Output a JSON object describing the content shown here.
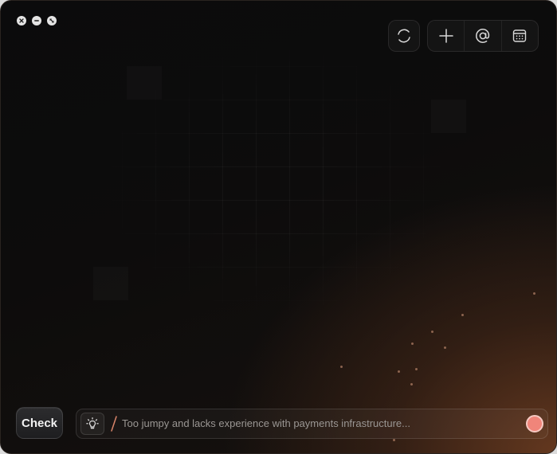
{
  "window": {
    "controls": [
      {
        "name": "close-icon"
      },
      {
        "name": "minimize-icon"
      },
      {
        "name": "fullscreen-icon"
      }
    ]
  },
  "toolbar": {
    "icons": [
      "refresh-icon",
      "plus-icon",
      "at-sign-icon",
      "calendar-icon"
    ]
  },
  "bottom": {
    "check_label": "Check",
    "hint_icon": "lightbulb-icon",
    "prompt_placeholder": "Too jumpy and lacks experience with payments infrastructure...",
    "record_icon": "record-icon"
  },
  "colors": {
    "accent": "#f0857a",
    "slash": "#d9846a",
    "background_glow": "#683a20"
  }
}
